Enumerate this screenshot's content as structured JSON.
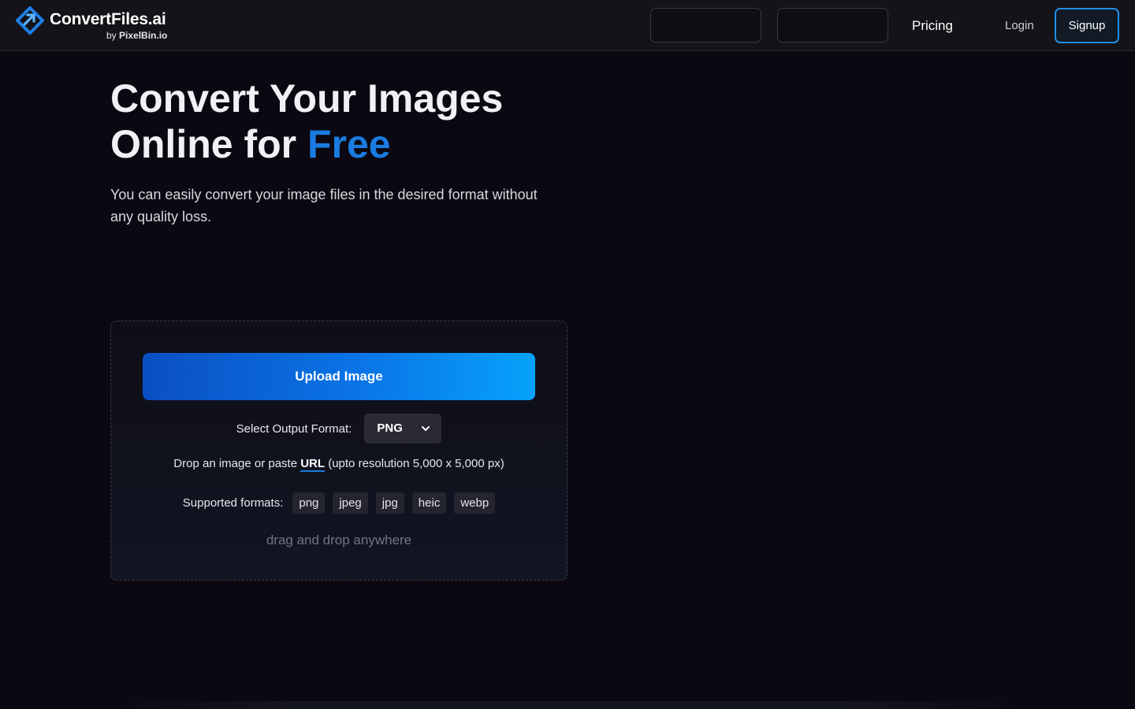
{
  "brand": {
    "name": "ConvertFiles.ai",
    "by_prefix": "by",
    "by_name": "PixelBin.io",
    "colors": {
      "accent": "#1a7be0",
      "accent_light": "#06a2fb",
      "background": "#0b0812",
      "navbar": "#141318"
    }
  },
  "nav": {
    "pricing": "Pricing",
    "login": "Login",
    "signup": "Signup"
  },
  "hero": {
    "title_line1": "Convert Your Images",
    "title_line2_prefix": "Online for ",
    "title_accent": "Free",
    "description": "You can easily convert your image files in the desired format without any quality loss."
  },
  "uploader": {
    "upload_button": "Upload Image",
    "format_label": "Select Output Format:",
    "selected_format": "PNG",
    "drop_prefix": "Drop an image or paste ",
    "drop_link": "URL",
    "drop_suffix": " (upto resolution 5,000 x 5,000 px)",
    "supported_label": "Supported formats:",
    "supported_formats": [
      "png",
      "jpeg",
      "jpg",
      "heic",
      "webp"
    ],
    "drag_hint": "drag and drop anywhere"
  },
  "icons": {
    "logo": "convertfiles-logo-icon",
    "select_chevron": "chevron-down-icon"
  }
}
